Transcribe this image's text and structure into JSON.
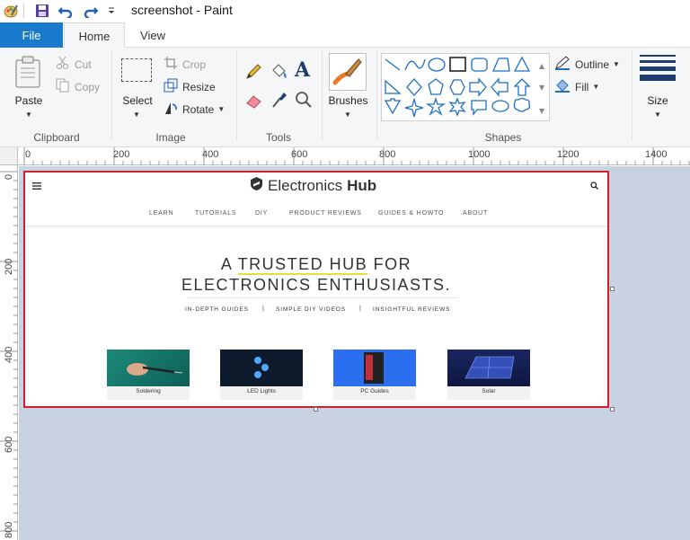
{
  "app": {
    "title": "screenshot - Paint"
  },
  "tabs": [
    {
      "label": "File"
    },
    {
      "label": "Home"
    },
    {
      "label": "View"
    }
  ],
  "ribbon": {
    "clipboard": {
      "label": "Clipboard",
      "paste": "Paste",
      "cut": "Cut",
      "copy": "Copy"
    },
    "image": {
      "label": "Image",
      "select": "Select",
      "crop": "Crop",
      "resize": "Resize",
      "rotate": "Rotate"
    },
    "tools": {
      "label": "Tools"
    },
    "brushes": {
      "label": "Brushes"
    },
    "shapes": {
      "label": "Shapes",
      "outline": "Outline",
      "fill": "Fill"
    },
    "size": {
      "label": "Size"
    }
  },
  "rulers": {
    "horizontal": [
      "0",
      "200",
      "400",
      "600",
      "800",
      "1000",
      "1200",
      "1400"
    ],
    "vertical": [
      "0",
      "200",
      "400",
      "600",
      "800"
    ]
  },
  "website": {
    "logo_light": "Electronics",
    "logo_bold": "Hub",
    "nav": [
      "LEARN",
      "TUTORIALS",
      "DIY",
      "PRODUCT REVIEWS",
      "GUIDES & HOWTO",
      "ABOUT"
    ],
    "hero_line1_a": "A ",
    "hero_line1_hl": "TRUSTED HUB",
    "hero_line1_b": " FOR",
    "hero_line2": "ELECTRONICS ENTHUSIASTS.",
    "taglines": [
      "IN-DEPTH GUIDES",
      "SIMPLE DIY VIDEOS",
      "INSIGHTFUL REVIEWS"
    ],
    "tag_separator": "|",
    "cards": [
      {
        "label": "Soldering"
      },
      {
        "label": "LED Lights"
      },
      {
        "label": "PC Guides"
      },
      {
        "label": "Solar"
      }
    ]
  },
  "colors": {
    "file_tab": "#1979ca",
    "canvas_border": "#d0202a",
    "workspace": "#c9d2e3",
    "highlight": "#e8df3a"
  }
}
